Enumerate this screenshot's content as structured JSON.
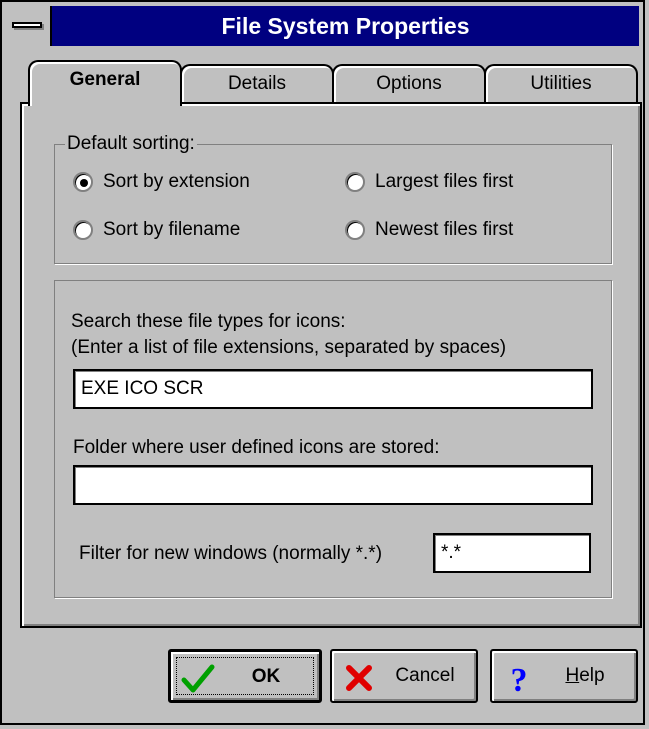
{
  "window": {
    "title": "File System Properties"
  },
  "tabs": [
    "General",
    "Details",
    "Options",
    "Utilities"
  ],
  "sorting": {
    "legend": "Default sorting:",
    "options": [
      {
        "label": "Sort by extension",
        "checked": true
      },
      {
        "label": "Largest files first",
        "checked": false
      },
      {
        "label": "Sort by filename",
        "checked": false
      },
      {
        "label": "Newest files first",
        "checked": false
      }
    ]
  },
  "icons": {
    "label_line1": "Search these file types for icons:",
    "label_line2": "(Enter a list of file extensions, separated by spaces)",
    "file_types_value": "EXE ICO SCR",
    "folder_label": "Folder where user defined icons are stored:",
    "folder_value": "",
    "filter_label": "Filter for new windows (normally *.*)",
    "filter_value": "*.*"
  },
  "buttons": {
    "ok": "OK",
    "cancel": "Cancel",
    "help_mnemonic": "H",
    "help_rest": "elp"
  },
  "icon_names": {
    "ok": "checkmark-icon",
    "cancel": "red-x-icon",
    "help": "question-mark-icon",
    "system_menu": "system-menu-icon"
  },
  "colors": {
    "title_bar": "#000080",
    "face": "#c0c0c0",
    "ok_check": "#00a000",
    "cancel_x": "#e00000",
    "help_q": "#0000ff"
  }
}
